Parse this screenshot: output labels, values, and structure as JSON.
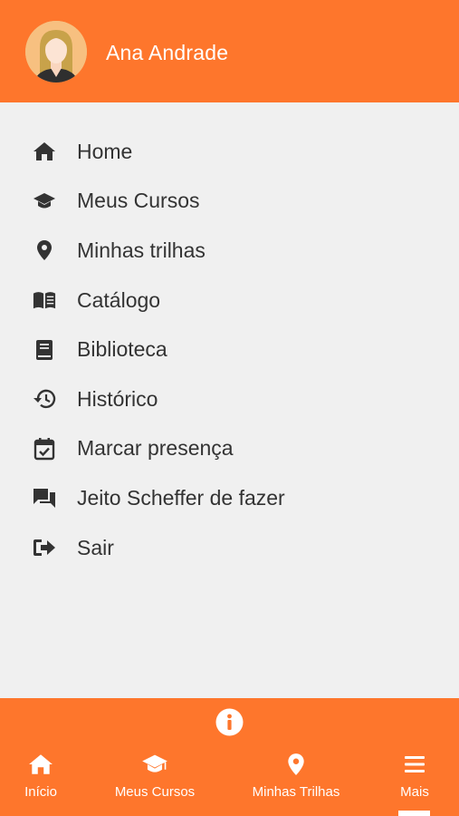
{
  "user": {
    "name": "Ana Andrade"
  },
  "menu": {
    "items": [
      {
        "label": "Home",
        "icon": "home-icon"
      },
      {
        "label": "Meus Cursos",
        "icon": "graduation-cap-icon"
      },
      {
        "label": "Minhas trilhas",
        "icon": "map-pin-icon"
      },
      {
        "label": "Catálogo",
        "icon": "open-book-icon"
      },
      {
        "label": "Biblioteca",
        "icon": "book-icon"
      },
      {
        "label": "Histórico",
        "icon": "history-icon"
      },
      {
        "label": "Marcar presença",
        "icon": "calendar-check-icon"
      },
      {
        "label": "Jeito Scheffer de fazer",
        "icon": "chat-icon"
      },
      {
        "label": "Sair",
        "icon": "sign-out-icon"
      }
    ]
  },
  "bottom_nav": {
    "tabs": [
      {
        "label": "Início",
        "icon": "home-icon"
      },
      {
        "label": "Meus Cursos",
        "icon": "graduation-cap-icon"
      },
      {
        "label": "Minhas Trilhas",
        "icon": "map-pin-icon"
      },
      {
        "label": "Mais",
        "icon": "menu-icon",
        "active": true
      }
    ]
  },
  "colors": {
    "accent": "#fe762c",
    "background": "#f0f0f0",
    "text": "#333333",
    "header_text": "#ffffff"
  }
}
